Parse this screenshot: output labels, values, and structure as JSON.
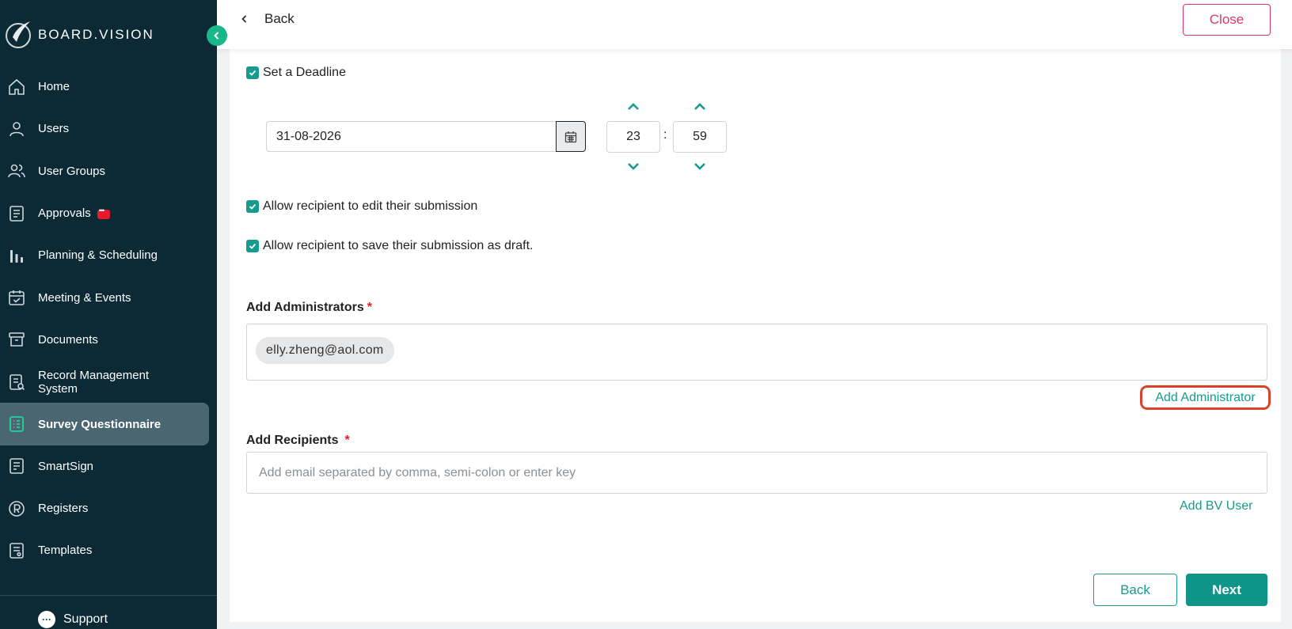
{
  "sidebar": {
    "brand": "BOARD.VISION",
    "items": [
      {
        "label": "Home",
        "icon": "home-icon"
      },
      {
        "label": "Users",
        "icon": "user-icon"
      },
      {
        "label": "User Groups",
        "icon": "user-group-icon"
      },
      {
        "label": "Approvals",
        "icon": "document-icon",
        "badge": "chat-badge"
      },
      {
        "label": "Planning & Scheduling",
        "icon": "bar-chart-icon"
      },
      {
        "label": "Meeting & Events",
        "icon": "calendar-check-icon"
      },
      {
        "label": "Documents",
        "icon": "archive-icon"
      },
      {
        "label": "Record Management System",
        "icon": "record-icon"
      },
      {
        "label": "Survey Questionnaire",
        "icon": "survey-icon",
        "active": true
      },
      {
        "label": "SmartSign",
        "icon": "sign-icon"
      },
      {
        "label": "Registers",
        "icon": "registered-icon"
      },
      {
        "label": "Templates",
        "icon": "template-icon"
      }
    ],
    "support_label": "Support"
  },
  "topbar": {
    "back_label": "Back",
    "close_label": "Close"
  },
  "form": {
    "deadline_label": "Set a Deadline",
    "deadline_checked": true,
    "date_value": "31-08-2026",
    "hour_value": "23",
    "minute_value": "59",
    "time_separator": ":",
    "allow_edit_label": "Allow recipient to edit their submission",
    "allow_edit_checked": true,
    "allow_draft_label": "Allow recipient to save their submission as draft.",
    "allow_draft_checked": true,
    "admins_title": "Add Administrators",
    "required_mark": "*",
    "admin_chip": "elly.zheng@aol.com",
    "add_admin_label": "Add Administrator",
    "recipients_title": "Add Recipients",
    "recipients_placeholder": "Add email separated by comma, semi-colon or enter key",
    "add_bv_user_label": "Add BV User",
    "back_button": "Back",
    "next_button": "Next"
  },
  "colors": {
    "sidebar_bg": "#0b2a35",
    "accent_teal": "#169c8f",
    "close_pink": "#e0336b",
    "highlight_red": "#d9432e"
  }
}
